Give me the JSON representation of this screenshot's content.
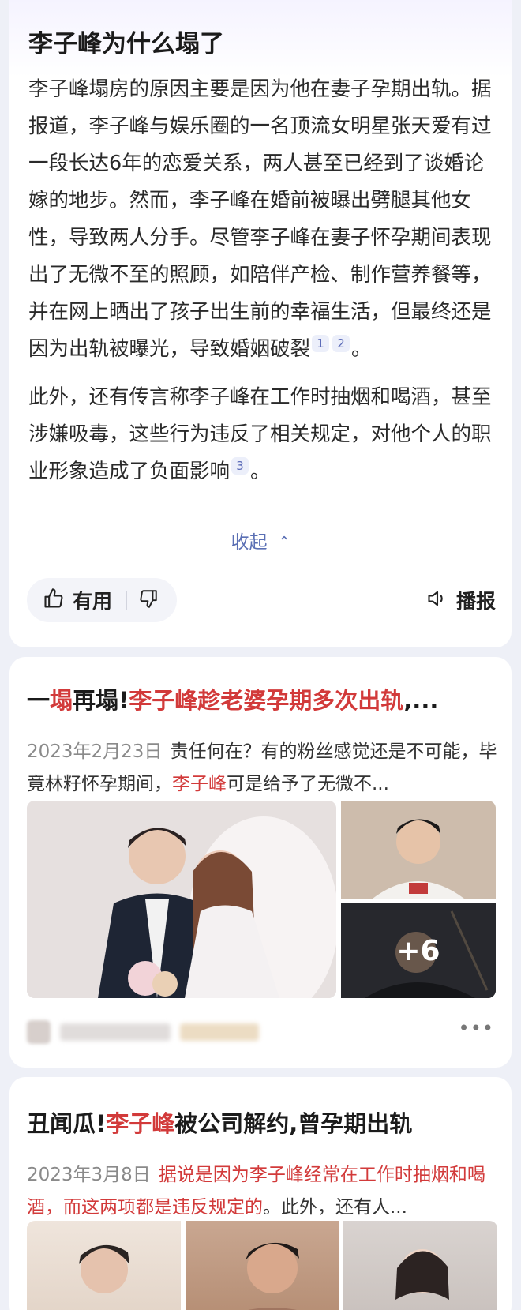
{
  "answer": {
    "title": "李子峰为什么塌了",
    "para1": "李子峰塌房的原因主要是因为他在妻子孕期出轨。据报道，李子峰与娱乐圈的一名顶流女明星张天爱有过一段长达6年的恋爱关系，两人甚至已经到了谈婚论嫁的地步。然而，李子峰在婚前被曝出劈腿其他女性，导致两人分手。尽管李子峰在妻子怀孕期间表现出了无微不至的照顾，如陪伴产检、制作营养餐等，并在网上晒出了孩子出生前的幸福生活，但最终还是因为出轨被曝光，导致婚姻破裂",
    "para1_cites": [
      "1",
      "2"
    ],
    "para1_end": "。",
    "para2": "此外，还有传言称李子峰在工作时抽烟和喝酒，甚至涉嫌吸毒，这些行为违反了相关规定，对他个人的职业形象造成了负面影响",
    "para2_cites": [
      "3"
    ],
    "para2_end": "。",
    "collapse_label": "收起",
    "useful_label": "有用",
    "broadcast_label": "播报",
    "icons": [
      "thumbs-up-icon",
      "thumbs-down-icon",
      "speaker-icon",
      "chevron-up-icon"
    ]
  },
  "results": [
    {
      "title_pre": "一",
      "title_hl1": "塌",
      "title_mid": "再塌!",
      "title_hl2": "李子峰趁老婆孕期多次出轨",
      "title_post": ",...",
      "date": "2023年2月23日",
      "snippet_a": "责任何在？有的粉丝感觉还是不可能，毕竟林籽怀孕期间，",
      "snippet_hl": "李子峰",
      "snippet_b": "可是给予了无微不...",
      "more_images": "+6",
      "more_icon": "more-dots-icon"
    },
    {
      "title_pre": "丑闻瓜!",
      "title_hl": "李子峰",
      "title_post": "被公司解约,曾孕期出轨",
      "date": "2023年3月8日",
      "snippet_hl": "据说是因为李子峰经常在工作时抽烟和喝酒，而这两项都是违反规定的",
      "snippet_b": "。此外，还有人..."
    }
  ],
  "colors": {
    "accent_blue": "#5a6fb4",
    "highlight_red": "#d23a3a",
    "background": "#eef0f7"
  }
}
